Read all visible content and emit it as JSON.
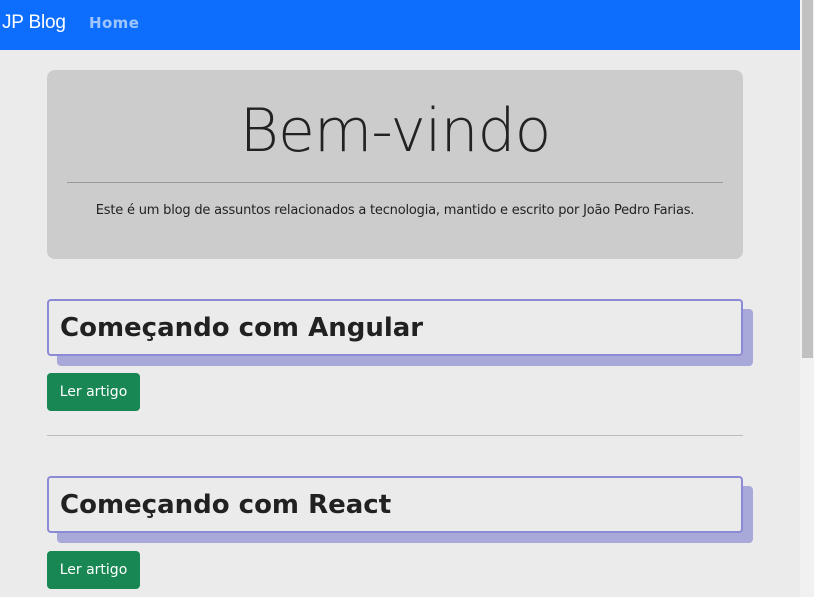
{
  "navbar": {
    "brand": "JP Blog",
    "links": [
      {
        "label": "Home"
      }
    ]
  },
  "hero": {
    "title": "Bem-vindo",
    "lead": "Este é um blog de assuntos relacionados a tecnologia, mantido e escrito por João Pedro Farias."
  },
  "posts": [
    {
      "title": "Começando com Angular",
      "button_label": "Ler artigo"
    },
    {
      "title": "Começando com React",
      "button_label": "Ler artigo"
    }
  ],
  "colors": {
    "navbar": "#0d6efd",
    "button": "#198754",
    "card_border": "#8a8ad6",
    "card_shadow": "#a9a9d9",
    "hero_bg": "#cccccc",
    "page_bg": "#ebebeb"
  }
}
